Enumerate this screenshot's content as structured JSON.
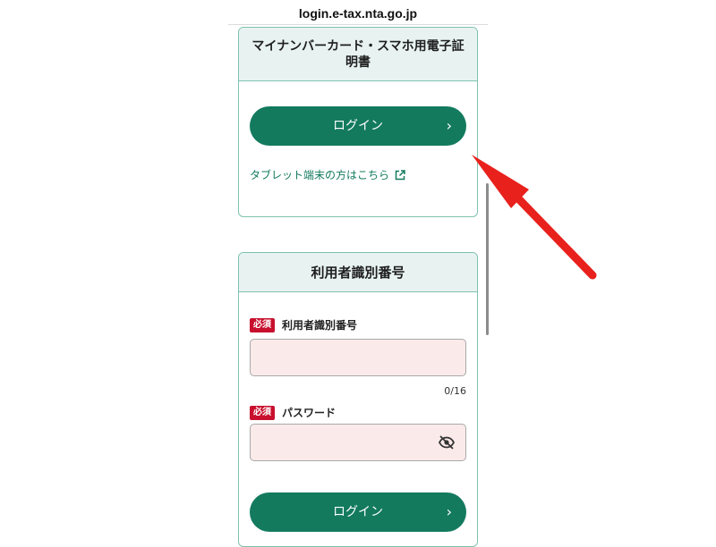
{
  "browser": {
    "url": "login.e-tax.nta.go.jp"
  },
  "mynumber_card": {
    "title": "マイナンバーカード・スマホ用電子証明書",
    "login_button_label": "ログイン",
    "tablet_link_label": "タブレット端末の方はこちら"
  },
  "user_id_card": {
    "title": "利用者識別番号",
    "required_badge": "必須",
    "user_id_label": "利用者識別番号",
    "user_id_value": "",
    "user_id_counter": "0/16",
    "password_label": "パスワード",
    "password_value": "",
    "login_button_label": "ログイン"
  },
  "icons": {
    "chevron": "chevron-right-icon",
    "external": "external-link-icon",
    "eye": "eye-off-icon"
  },
  "colors": {
    "accent": "#137a5e",
    "card_border": "#7fc1b0",
    "card_header_bg": "#e8f3f1",
    "badge": "#c8102e",
    "input_bg": "#fbeaea",
    "annotation_arrow": "#e8211d"
  }
}
